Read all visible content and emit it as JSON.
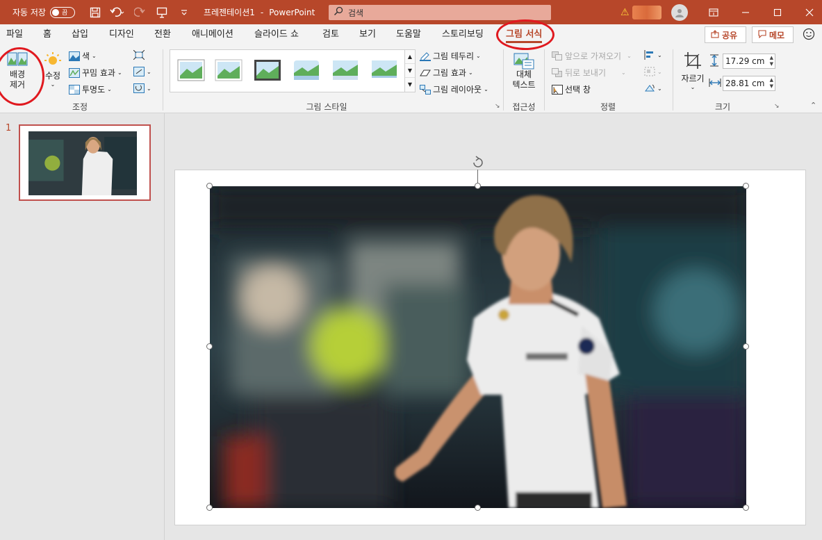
{
  "titlebar": {
    "autosave_label": "자동 저장",
    "autosave_state": "끔",
    "doc_title": "프레젠테이션1",
    "separator": "-",
    "app_name": "PowerPoint",
    "search_placeholder": "검색",
    "warning": "⚠",
    "qa_icons": [
      "save-icon",
      "undo-icon",
      "redo-icon",
      "present-icon",
      "customize-icon"
    ]
  },
  "tabs": [
    "파일",
    "홈",
    "삽입",
    "디자인",
    "전환",
    "애니메이션",
    "슬라이드 쇼",
    "검토",
    "보기",
    "도움말",
    "스토리보딩",
    "그림 서식"
  ],
  "active_tab": "그림 서식",
  "share_label": "공유",
  "comments_label": "메모",
  "ribbon": {
    "adjust": {
      "remove_bg": "배경\n제거",
      "corrections": "수정",
      "color": "색",
      "artistic": "꾸밈 효과",
      "transparency": "투명도",
      "group_label": "조정"
    },
    "styles": {
      "border": "그림 테두리",
      "effects": "그림 효과",
      "layout": "그림 레이아웃",
      "group_label": "그림 스타일"
    },
    "accessibility": {
      "alt_text": "대체\n텍스트",
      "group_label": "접근성"
    },
    "arrange": {
      "bring_forward": "앞으로 가져오기",
      "send_backward": "뒤로 보내기",
      "selection_pane": "선택 창",
      "group_label": "정렬"
    },
    "size": {
      "crop": "자르기",
      "height": "17.29 cm",
      "width": "28.81 cm",
      "group_label": "크기"
    }
  },
  "slides": {
    "slide_number": "1"
  },
  "colors": {
    "accent": "#b7472a",
    "highlight_circle": "#e0191f"
  }
}
